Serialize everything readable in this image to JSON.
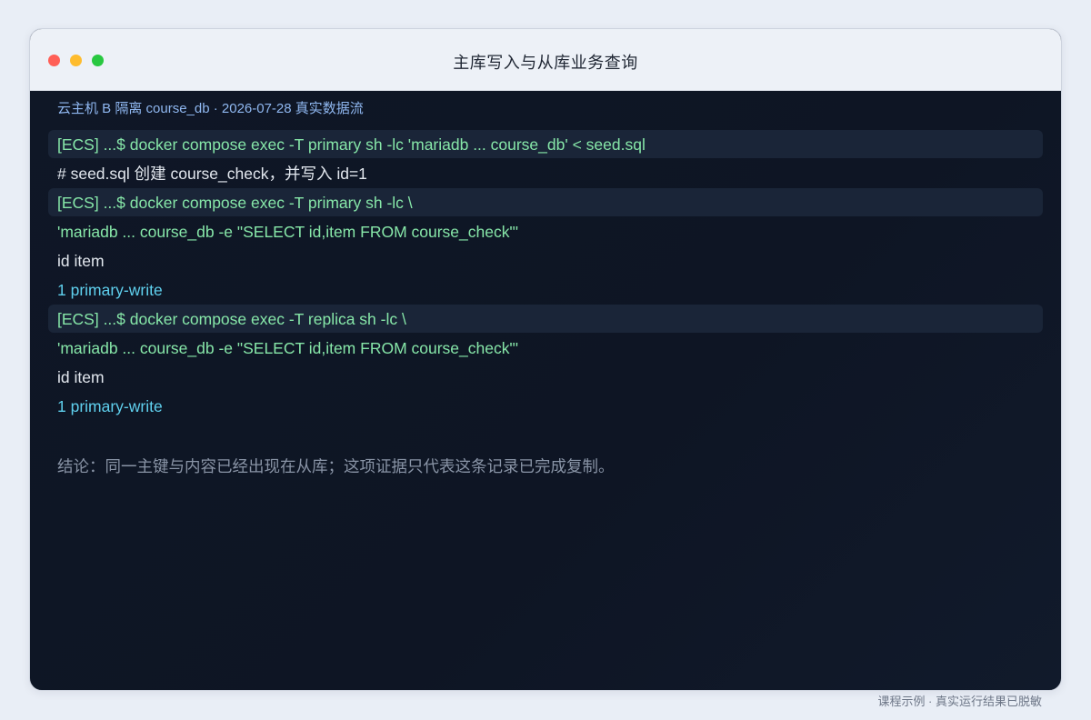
{
  "window": {
    "title": "主库写入与从库业务查询",
    "controls": {
      "close_color": "#ff5f57",
      "minimize_color": "#febc2e",
      "zoom_color": "#28c840"
    }
  },
  "terminal": {
    "host_line": "云主机 B 隔离 course_db · 2026-07-28 真实数据流",
    "lines": [
      {
        "kind": "cmd",
        "text": "[ECS] ...$ docker compose exec -T primary sh -lc 'mariadb ... course_db' < seed.sql"
      },
      {
        "kind": "comment",
        "text": "# seed.sql 创建 course_check，并写入 id=1"
      },
      {
        "kind": "cmd",
        "text": "[ECS] ...$ docker compose exec -T primary sh -lc \\"
      },
      {
        "kind": "cont",
        "text": "'mariadb ... course_db -e \"SELECT id,item FROM course_check\"'"
      },
      {
        "kind": "header",
        "text": "id   item"
      },
      {
        "kind": "row",
        "text": "1    primary-write"
      },
      {
        "kind": "cmd",
        "text": "[ECS] ...$ docker compose exec -T replica sh -lc \\"
      },
      {
        "kind": "cont",
        "text": "'mariadb ... course_db -e \"SELECT id,item FROM course_check\"'"
      },
      {
        "kind": "header",
        "text": "id   item"
      },
      {
        "kind": "row",
        "text": "1    primary-write"
      }
    ],
    "conclusion": "结论：同一主键与内容已经出现在从库；这项证据只代表这条记录已完成复制。"
  },
  "footer": {
    "note": "课程示例 · 真实运行结果已脱敏"
  }
}
